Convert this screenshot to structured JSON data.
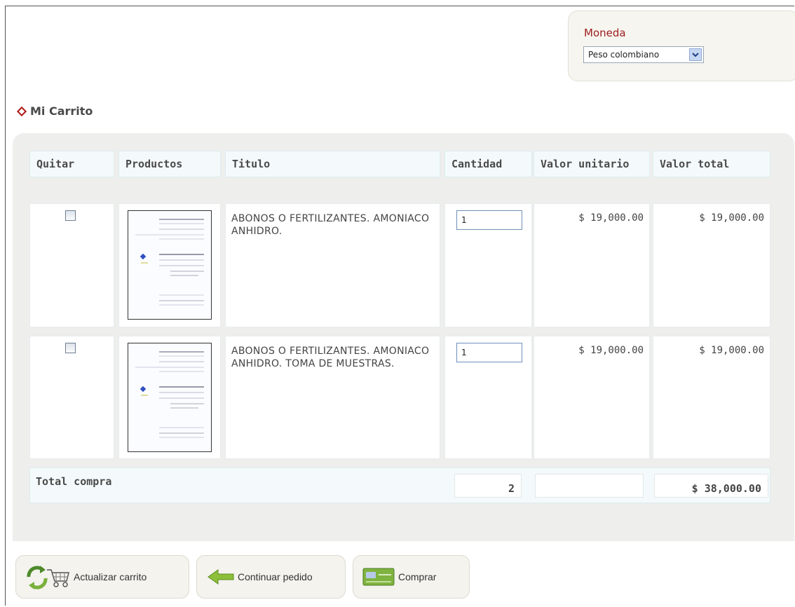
{
  "currency": {
    "label": "Moneda",
    "selected": "Peso colombiano"
  },
  "section_title": "Mi Carrito",
  "table": {
    "headers": {
      "remove": "Quitar",
      "products": "Productos",
      "title": "Titulo",
      "quantity": "Cantidad",
      "unit_price": "Valor unitario",
      "total_price": "Valor total"
    },
    "rows": [
      {
        "title": "ABONOS O FERTILIZANTES. AMONIACO ANHIDRO.",
        "quantity": "1",
        "unit_price": "$ 19,000.00",
        "total_price": "$ 19,000.00"
      },
      {
        "title": "ABONOS O FERTILIZANTES. AMONIACO ANHIDRO. TOMA DE MUESTRAS.",
        "quantity": "1",
        "unit_price": "$ 19,000.00",
        "total_price": "$ 19,000.00"
      }
    ],
    "totals": {
      "label": "Total compra",
      "quantity": "2",
      "unit_price": "",
      "amount": "$ 38,000.00"
    }
  },
  "buttons": {
    "update": "Actualizar carrito",
    "continue": "Continuar pedido",
    "buy": "Comprar"
  },
  "colors": {
    "accent_red": "#9b1c1c",
    "panel_bg": "#eeeeec",
    "header_bg": "#f4fafb"
  }
}
